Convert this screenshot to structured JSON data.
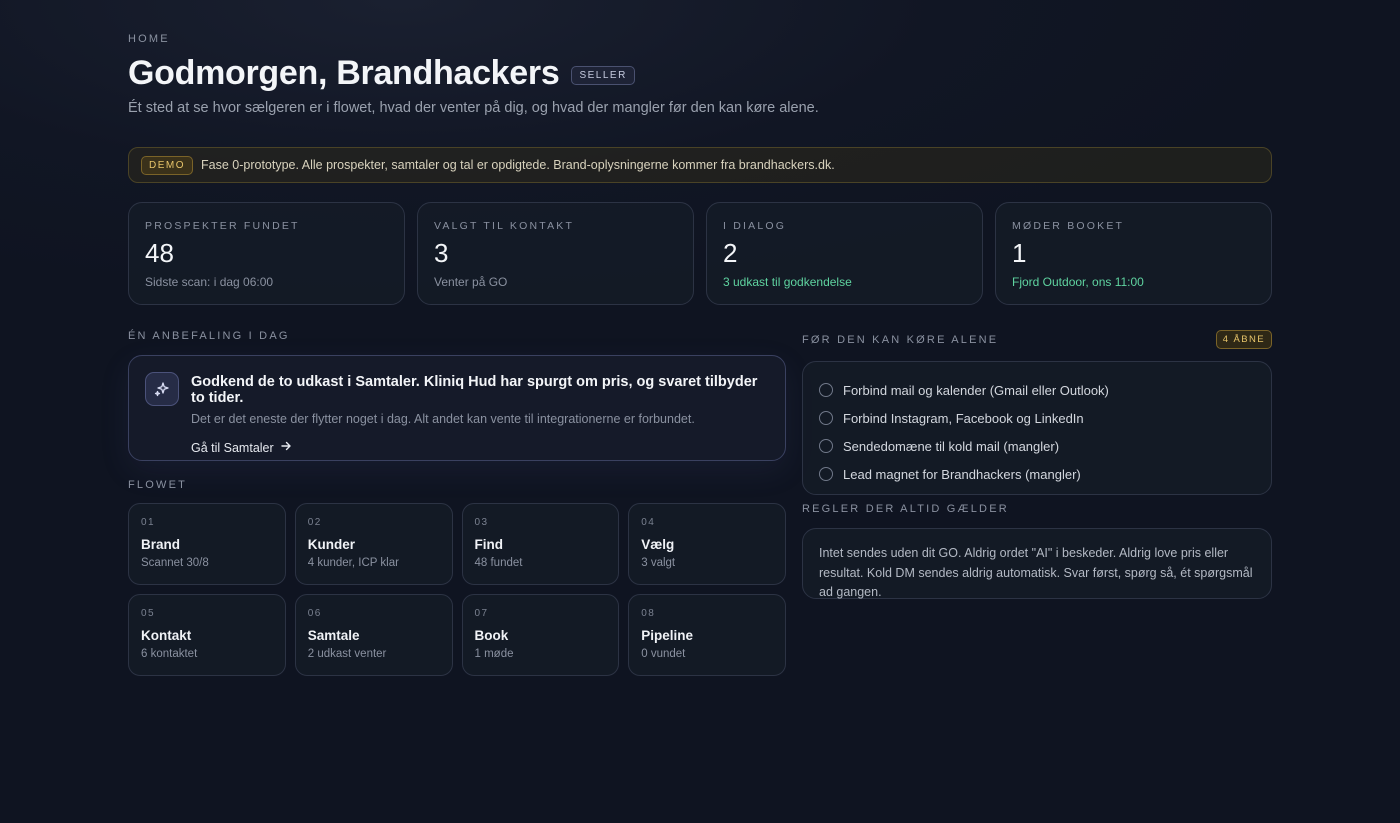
{
  "header": {
    "breadcrumb": "HOME",
    "title": "Godmorgen, Brandhackers",
    "role_badge": "SELLER",
    "subtitle": "Ét sted at se hvor sælgeren er i flowet, hvad der venter på dig, og hvad der mangler før den kan køre alene."
  },
  "banner": {
    "tag": "DEMO",
    "text": "Fase 0-prototype. Alle prospekter, samtaler og tal er opdigtede. Brand-oplysningerne kommer fra brandhackers.dk."
  },
  "stats": [
    {
      "label": "PROSPEKTER FUNDET",
      "value": "48",
      "note": "Sidste scan: i dag 06:00"
    },
    {
      "label": "VALGT TIL KONTAKT",
      "value": "3",
      "note": "Venter på GO"
    },
    {
      "label": "I DIALOG",
      "value": "2",
      "note": "3 udkast til godkendelse"
    },
    {
      "label": "MØDER BOOKET",
      "value": "1",
      "note": "Fjord Outdoor, ons 11:00"
    }
  ],
  "recommendation": {
    "section_label": "ÉN ANBEFALING I DAG",
    "icon": "sparkle-icon",
    "title": "Godkend de to udkast i Samtaler. Kliniq Hud har spurgt om pris, og svaret tilbyder to tider.",
    "description": "Det er det eneste der flytter noget i dag. Alt andet kan vente til integrationerne er forbundet.",
    "link_label": "Gå til Samtaler"
  },
  "flow": {
    "section_label": "FLOWET",
    "steps": [
      {
        "num": "01",
        "name": "Brand",
        "sub": "Scannet 30/8"
      },
      {
        "num": "02",
        "name": "Kunder",
        "sub": "4 kunder, ICP klar"
      },
      {
        "num": "03",
        "name": "Find",
        "sub": "48 fundet"
      },
      {
        "num": "04",
        "name": "Vælg",
        "sub": "3 valgt"
      },
      {
        "num": "05",
        "name": "Kontakt",
        "sub": "6 kontaktet"
      },
      {
        "num": "06",
        "name": "Samtale",
        "sub": "2 udkast venter"
      },
      {
        "num": "07",
        "name": "Book",
        "sub": "1 møde"
      },
      {
        "num": "08",
        "name": "Pipeline",
        "sub": "0 vundet"
      }
    ]
  },
  "checklist": {
    "section_label": "FØR DEN KAN KØRE ALENE",
    "open_badge": "4 ÅBNE",
    "items": [
      "Forbind mail og kalender (Gmail eller Outlook)",
      "Forbind Instagram, Facebook og LinkedIn",
      "Sendedomæne til kold mail (mangler)",
      "Lead magnet for Brandhackers (mangler)"
    ]
  },
  "rules": {
    "section_label": "REGLER DER ALTID GÆLDER",
    "text": "Intet sendes uden dit GO. Aldrig ordet \"AI\" i beskeder. Aldrig love pris eller resultat. Kold DM sendes aldrig automatisk. Svar først, spørg så, ét spørgsmål ad gangen."
  },
  "colors": {
    "accent_green": "#5fd3a0",
    "accent_gold": "#e7c46a"
  }
}
